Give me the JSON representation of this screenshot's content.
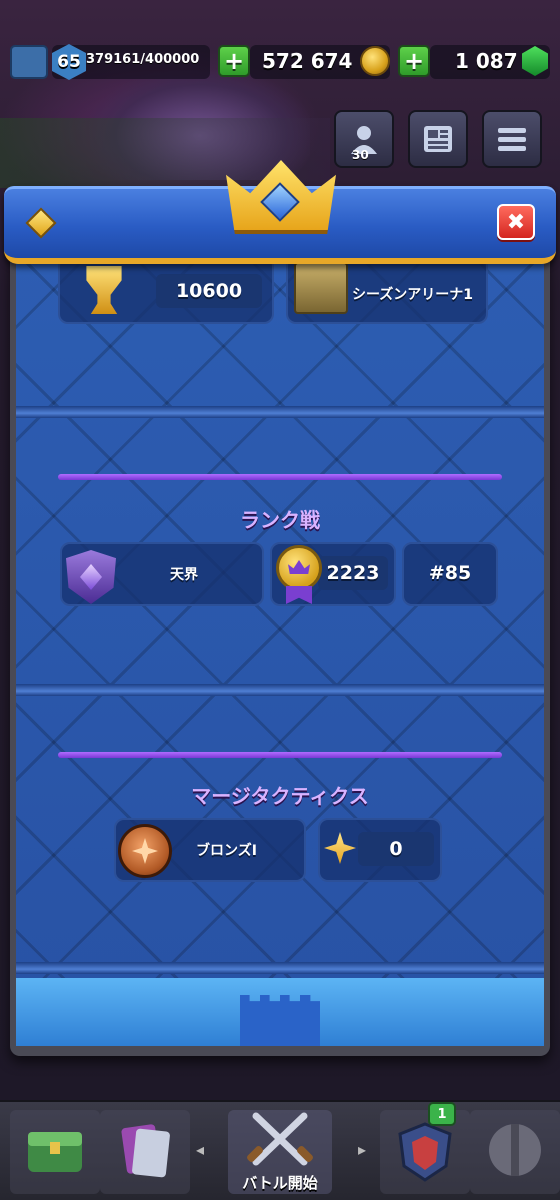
{
  "topbar": {
    "level": "65",
    "xp": "379161/400000",
    "gold": "572 674",
    "gems": "1 087",
    "plus_label": "+"
  },
  "side_buttons": {
    "friends_count": "30"
  },
  "header": {
    "close_label": "✖"
  },
  "trophy_section": {
    "trophies": "10600",
    "arena_name": "シーズンアリーナ1"
  },
  "ranked": {
    "title": "ランク戦",
    "tier": "天界",
    "rating": "2223",
    "rank": "#85"
  },
  "merge_tactics": {
    "title": "マージタクティクス",
    "league": "ブロンズI",
    "points": "0"
  },
  "bottom_nav": {
    "battle_label": "バトル開始",
    "notification_count": "1",
    "left_arrow": "◂",
    "right_arrow": "▸"
  },
  "colors": {
    "panel_blue": "#2a56a8",
    "accent_gold": "#e8a828",
    "purple_accent": "#b06cff",
    "close_red": "#d4261f"
  }
}
